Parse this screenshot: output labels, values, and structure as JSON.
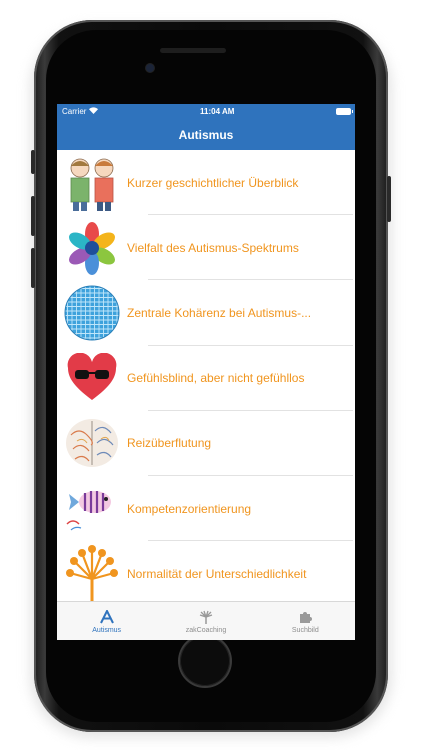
{
  "status_bar": {
    "carrier": "Carrier",
    "time": "11:04 AM"
  },
  "nav": {
    "title": "Autismus"
  },
  "items": [
    {
      "label": "Kurzer geschichtlicher Überblick",
      "icon": "two-children-drawing-icon"
    },
    {
      "label": "Vielfalt des Autismus-Spektrums",
      "icon": "colorful-flower-icon"
    },
    {
      "label": "Zentrale Kohärenz bei Autismus-...",
      "icon": "blue-mosaic-circle-icon"
    },
    {
      "label": "Gefühlsblind, aber nicht gefühllos",
      "icon": "heart-with-sunglasses-icon"
    },
    {
      "label": "Reizüberflutung",
      "icon": "brain-drawing-icon"
    },
    {
      "label": "Kompetenzorientierung",
      "icon": "striped-fish-icon"
    },
    {
      "label": "Normalität der Unterschiedlichkeit",
      "icon": "orange-dandelion-icon"
    }
  ],
  "tabs": [
    {
      "label": "Autismus",
      "icon": "letter-a-icon",
      "active": true
    },
    {
      "label": "zakCoaching",
      "icon": "flower-icon",
      "active": false
    },
    {
      "label": "Suchbild",
      "icon": "puzzle-icon",
      "active": false
    }
  ],
  "colors": {
    "primary": "#2f73bd",
    "accent": "#f0951f"
  }
}
